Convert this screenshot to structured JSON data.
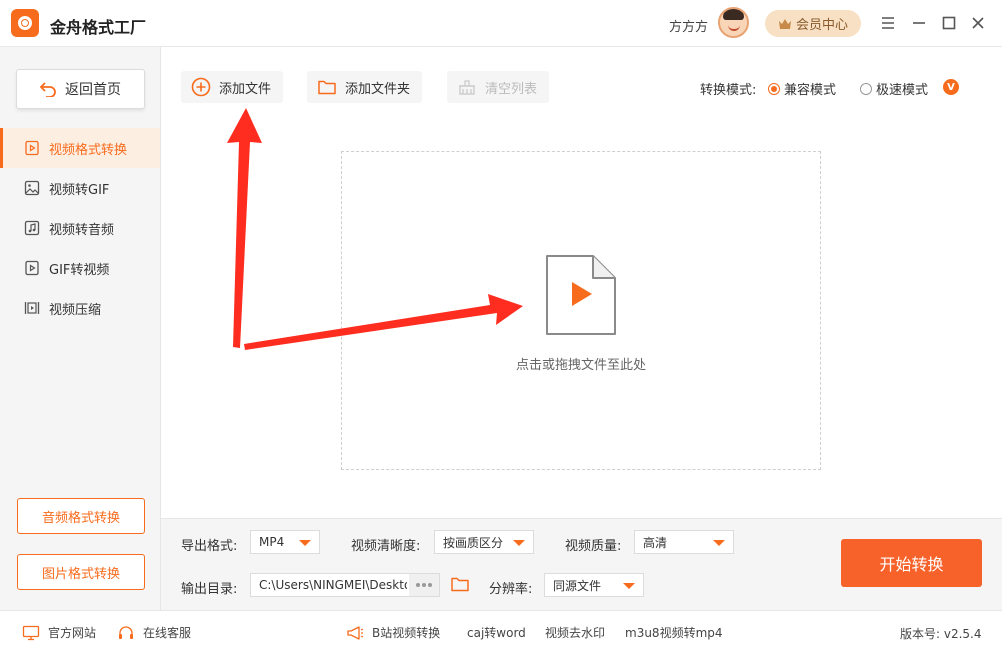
{
  "app": {
    "title": "金舟格式工厂",
    "username": "方方方",
    "vip_label": "会员中心"
  },
  "sidebar": {
    "back_label": "返回首页",
    "items": [
      {
        "label": "视频格式转换",
        "icon": "video-icon",
        "active": true
      },
      {
        "label": "视频转GIF",
        "icon": "image-icon",
        "active": false
      },
      {
        "label": "视频转音频",
        "icon": "music-icon",
        "active": false
      },
      {
        "label": "GIF转视频",
        "icon": "play-icon",
        "active": false
      },
      {
        "label": "视频压缩",
        "icon": "compress-icon",
        "active": false
      }
    ],
    "bottom_buttons": [
      "音频格式转换",
      "图片格式转换"
    ]
  },
  "toolbar": {
    "add_file": "添加文件",
    "add_folder": "添加文件夹",
    "clear_list": "清空列表",
    "mode_label": "转换模式:",
    "mode_compat": "兼容模式",
    "mode_fast": "极速模式",
    "vip_badge": "V",
    "selected_mode": "兼容模式"
  },
  "dropzone": {
    "hint": "点击或拖拽文件至此处"
  },
  "settings": {
    "format_label": "导出格式:",
    "format_value": "MP4",
    "clarity_label": "视频清晰度:",
    "clarity_value": "按画质区分",
    "quality_label": "视频质量:",
    "quality_value": "高清",
    "output_label": "输出目录:",
    "output_path": "C:\\Users\\NINGMEI\\Deskto",
    "resolution_label": "分辨率:",
    "resolution_value": "同源文件",
    "start_label": "开始转换"
  },
  "statusbar": {
    "website": "官方网站",
    "support": "在线客服",
    "links": [
      "B站视频转换",
      "caj转word",
      "视频去水印",
      "m3u8视频转mp4"
    ],
    "version": "版本号: v2.5.4"
  },
  "colors": {
    "accent": "#f76b1c",
    "arrow": "#ff2d1f"
  }
}
